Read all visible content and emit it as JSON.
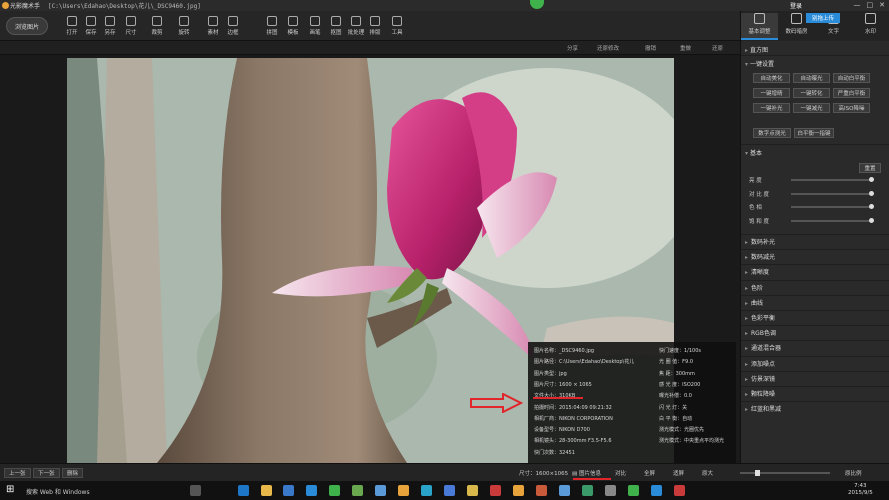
{
  "title_bar": {
    "app_name": "光影魔术手",
    "file_path": "[C:\\Users\\Edahao\\Desktop\\花儿\\_DSC9460.jpg]",
    "login": "登录",
    "minimize": "—",
    "maximize": "□",
    "close": "✕"
  },
  "toolbar": {
    "browse_label": "浏览图片",
    "tools": [
      {
        "label": "打开",
        "icon": "folder-icon"
      },
      {
        "label": "保存",
        "icon": "save-icon"
      },
      {
        "label": "另存",
        "icon": "save-as-icon"
      },
      {
        "label": "尺寸",
        "icon": "resize-icon"
      },
      {
        "label": "裁剪",
        "icon": "crop-icon"
      },
      {
        "label": "旋转",
        "icon": "rotate-icon"
      },
      {
        "label": "素材",
        "icon": "material-icon"
      },
      {
        "label": "边框",
        "icon": "frame-icon"
      },
      {
        "label": "拼图",
        "icon": "puzzle-icon"
      },
      {
        "label": "模板",
        "icon": "template-icon"
      },
      {
        "label": "画笔",
        "icon": "brush-icon"
      },
      {
        "label": "抠图",
        "icon": "cutout-icon"
      },
      {
        "label": "批处理",
        "icon": "batch-icon"
      },
      {
        "label": "排版",
        "icon": "layout-icon"
      },
      {
        "label": "工具",
        "icon": "tools-icon"
      }
    ]
  },
  "secondbar": {
    "share": "分享",
    "nav_prev": "还原修改",
    "undo": "撤销",
    "redo": "重做",
    "restore": "还原"
  },
  "info_panel": {
    "left": [
      "图片名称：_DSC9460.jpg",
      "图片路径：C:\\Users\\Edahao\\Desktop\\花儿",
      "图片类型：jpg",
      "图片尺寸：1600 × 1065",
      "文件大小：310KB",
      "拍摄时间：2015:04:09 09:21:32",
      "相机厂商：NIKON CORPORATION",
      "设备型号：NIKON D700",
      "相机镜头：28-300mm F3.5-F5.6",
      "快门次数：32451"
    ],
    "right": [
      "快门速度：1/100s",
      "光 圈 值：F9.0",
      "焦    距：300mm",
      "感 光 度：ISO200",
      "曝光补偿：0.0",
      "闪 光 灯：关",
      "白 平 衡：自动",
      "测光模式：光圈优先",
      "测光模式：中央重点平均测光"
    ]
  },
  "bottom_bar": {
    "prev": "上一张",
    "next": "下一张",
    "delete": "删除",
    "size": "尺寸：1600×1065",
    "info": "图片信息",
    "compare": "对比",
    "fullscreen": "全屏",
    "fit": "适屏",
    "original": "原大",
    "zoom": "原比例"
  },
  "right_panel": {
    "tabs": [
      {
        "label": "基本调整",
        "icon": "adjust-icon"
      },
      {
        "label": "数码暗房",
        "icon": "darkroom-icon"
      },
      {
        "label": "文字",
        "icon": "text-icon"
      },
      {
        "label": "水印",
        "icon": "watermark-icon"
      }
    ],
    "tooltip": "别拖上传",
    "histogram": "直方图",
    "one_click": "一键设置",
    "one_click_buttons": [
      "自动美化",
      "自动曝光",
      "自动白平衡",
      "一键增晴",
      "一键转化",
      "严重白平衡",
      "一键补光",
      "一键减光",
      "高ISO降噪"
    ],
    "extra_buttons": [
      "数字点测光",
      "白平衡一指键"
    ],
    "basic": "基本",
    "reset": "重置",
    "sliders": [
      "亮    度",
      "对 比 度",
      "色    相",
      "饱 和 度"
    ],
    "collapsed": [
      "数码补光",
      "数码减光",
      "清晰度",
      "色阶",
      "曲线",
      "色彩平衡",
      "RGB色调",
      "通道混合器",
      "添加噪点",
      "仿景深镜",
      "颗粒降噪",
      "红蓝和黑减"
    ]
  },
  "taskbar": {
    "search": "搜索 Web 和 Windows",
    "time": "7:43",
    "date": "2015/9/5"
  }
}
